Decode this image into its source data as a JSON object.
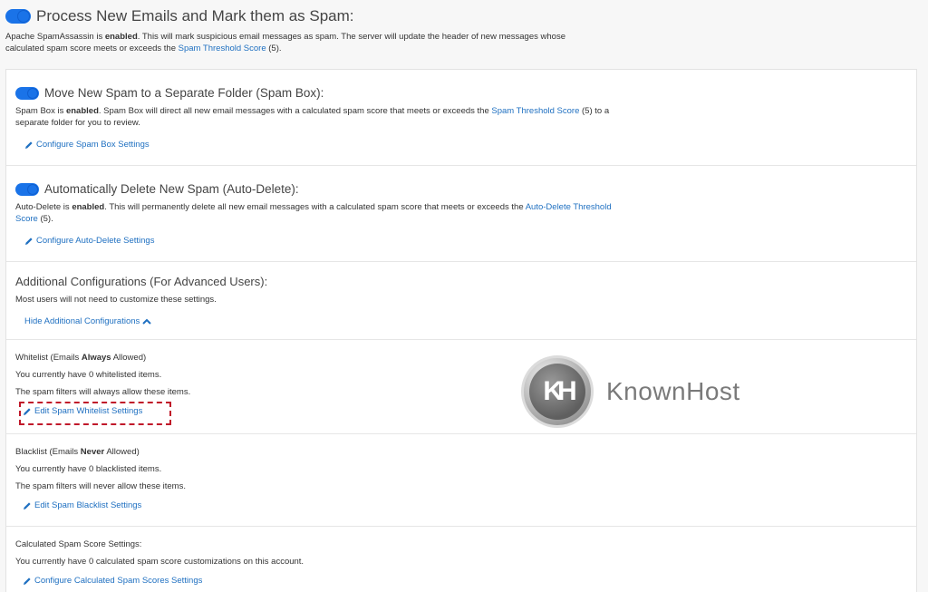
{
  "hero": {
    "title": "Process New Emails and Mark them as Spam:",
    "desc_prefix": "Apache SpamAssassin is ",
    "desc_bold": "enabled",
    "desc_mid": ". This will mark suspicious email messages as spam. The server will update the header of new messages whose calculated spam score meets or exceeds the ",
    "desc_link": "Spam Threshold Score",
    "desc_suffix": " (5)."
  },
  "spam_box": {
    "title": "Move New Spam to a Separate Folder (Spam Box):",
    "desc_prefix": "Spam Box is ",
    "desc_bold": "enabled",
    "desc_mid": ". Spam Box will direct all new email messages with a calculated spam score that meets or exceeds the ",
    "desc_link": "Spam Threshold Score",
    "desc_suffix": " (5) to a separate folder for you to review.",
    "action": "Configure Spam Box Settings"
  },
  "auto_delete": {
    "title": "Automatically Delete New Spam (Auto-Delete):",
    "desc_prefix": "Auto-Delete is ",
    "desc_bold": "enabled",
    "desc_mid": ". This will permanently delete all new email messages with a calculated spam score that meets or exceeds the ",
    "desc_link": "Auto-Delete Threshold Score",
    "desc_suffix": " (5).",
    "action": "Configure Auto-Delete Settings"
  },
  "additional": {
    "title": "Additional Configurations (For Advanced Users):",
    "desc": "Most users will not need to customize these settings.",
    "action": "Hide Additional Configurations"
  },
  "whitelist": {
    "label_prefix": "Whitelist (Emails ",
    "label_bold": "Always",
    "label_suffix": " Allowed)",
    "count": "You currently have 0 whitelisted items.",
    "note": "The spam filters will always allow these items.",
    "action": "Edit Spam Whitelist Settings"
  },
  "blacklist": {
    "label_prefix": "Blacklist (Emails ",
    "label_bold": "Never",
    "label_suffix": " Allowed)",
    "count": "You currently have 0 blacklisted items.",
    "note": "The spam filters will never allow these items.",
    "action": "Edit Spam Blacklist Settings"
  },
  "score": {
    "label": "Calculated Spam Score Settings:",
    "count": "You currently have 0 calculated spam score customizations on this account.",
    "action": "Configure Calculated Spam Scores Settings"
  },
  "watermark": {
    "badge": "KH",
    "word": "KnownHost"
  },
  "colors": {
    "link": "#1f70c1",
    "toggle": "#1a73e8",
    "highlight": "#c0182a"
  }
}
